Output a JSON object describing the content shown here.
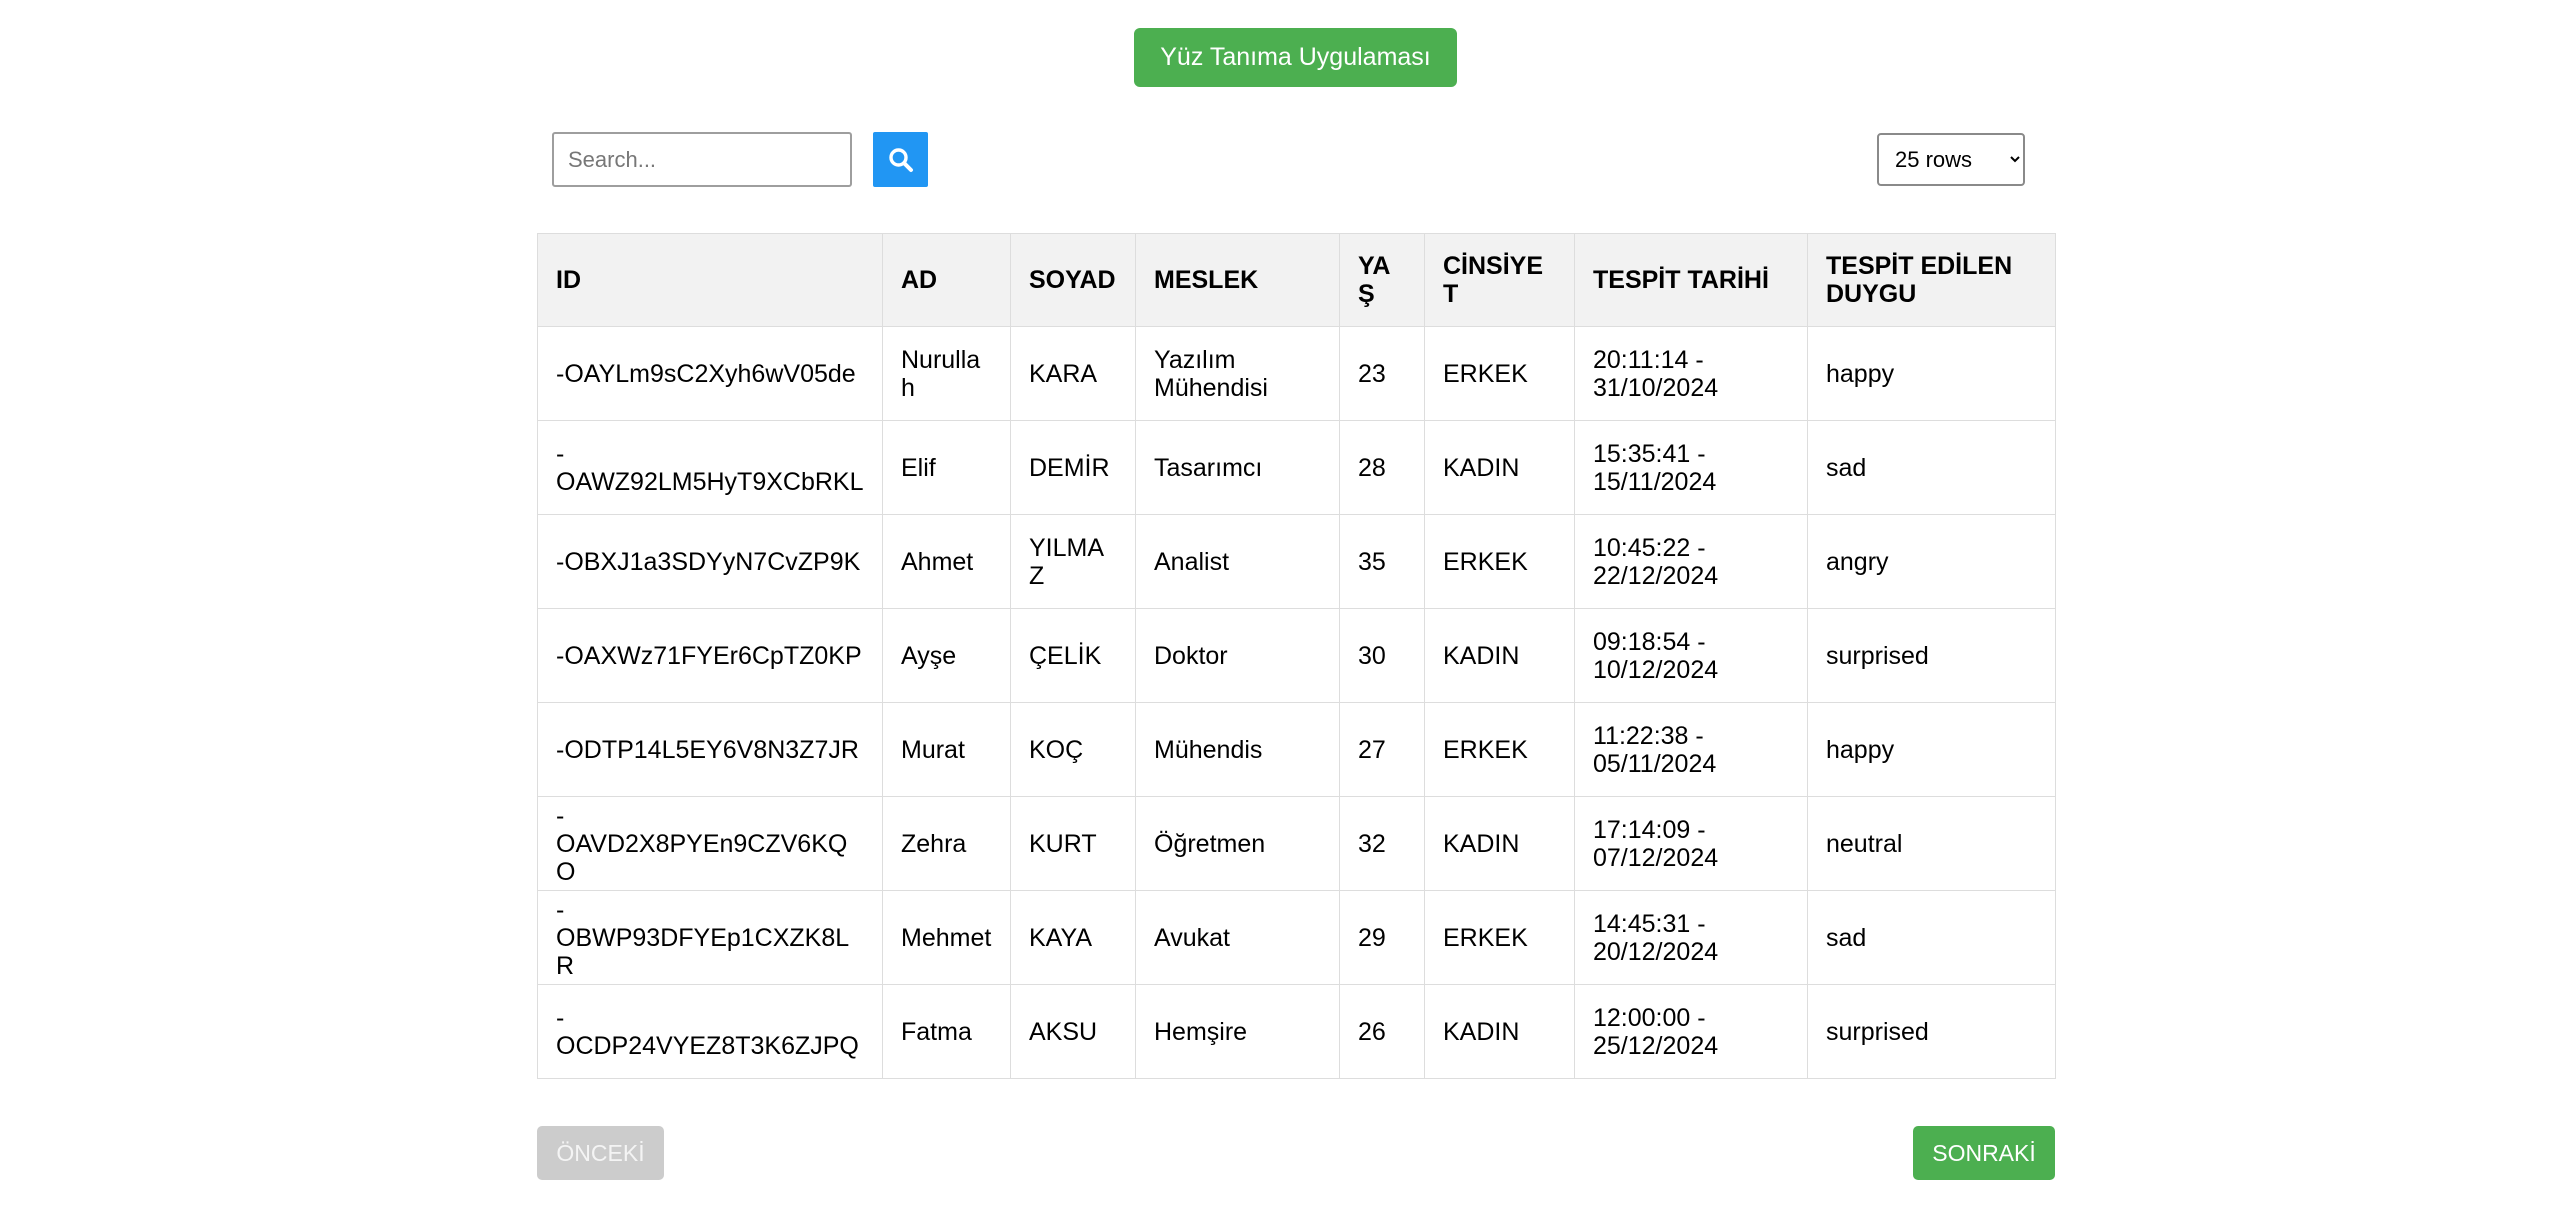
{
  "header": {
    "title_button": "Yüz Tanıma Uygulaması"
  },
  "toolbar": {
    "search_placeholder": "Search...",
    "search_value": "",
    "search_icon": "search-icon",
    "rows_selected": "25 rows"
  },
  "table": {
    "columns": [
      "ID",
      "AD",
      "SOYAD",
      "MESLEK",
      "YAŞ",
      "CİNSİYET",
      "TESPİT TARİHİ",
      "TESPİT EDİLEN DUYGU"
    ],
    "rows": [
      [
        "-OAYLm9sC2Xyh6wV05de",
        "Nurullah",
        "KARA",
        "Yazılım Mühendisi",
        "23",
        "ERKEK",
        "20:11:14 - 31/10/2024",
        "happy"
      ],
      [
        "-OAWZ92LM5HyT9XCbRKL",
        "Elif",
        "DEMİR",
        "Tasarımcı",
        "28",
        "KADIN",
        "15:35:41 - 15/11/2024",
        "sad"
      ],
      [
        "-OBXJ1a3SDYyN7CvZP9K",
        "Ahmet",
        "YILMAZ",
        "Analist",
        "35",
        "ERKEK",
        "10:45:22 - 22/12/2024",
        "angry"
      ],
      [
        "-OAXWz71FYEr6CpTZ0KP",
        "Ayşe",
        "ÇELİK",
        "Doktor",
        "30",
        "KADIN",
        "09:18:54 - 10/12/2024",
        "surprised"
      ],
      [
        "-ODTP14L5EY6V8N3Z7JR",
        "Murat",
        "KOÇ",
        "Mühendis",
        "27",
        "ERKEK",
        "11:22:38 - 05/11/2024",
        "happy"
      ],
      [
        "-OAVD2X8PYEn9CZV6KQO",
        "Zehra",
        "KURT",
        "Öğretmen",
        "32",
        "KADIN",
        "17:14:09 - 07/12/2024",
        "neutral"
      ],
      [
        "-OBWP93DFYEp1CXZK8LR",
        "Mehmet",
        "KAYA",
        "Avukat",
        "29",
        "ERKEK",
        "14:45:31 - 20/12/2024",
        "sad"
      ],
      [
        "-OCDP24VYEZ8T3K6ZJPQ",
        "Fatma",
        "AKSU",
        "Hemşire",
        "26",
        "KADIN",
        "12:00:00 - 25/12/2024",
        "surprised"
      ]
    ]
  },
  "pagination": {
    "prev_label": "ÖNCEKİ",
    "next_label": "SONRAKİ"
  },
  "colors": {
    "green": "#4caf50",
    "blue": "#2196f3",
    "disabled": "#cccccc",
    "header_bg": "#f2f2f2",
    "border": "#dddddd"
  }
}
